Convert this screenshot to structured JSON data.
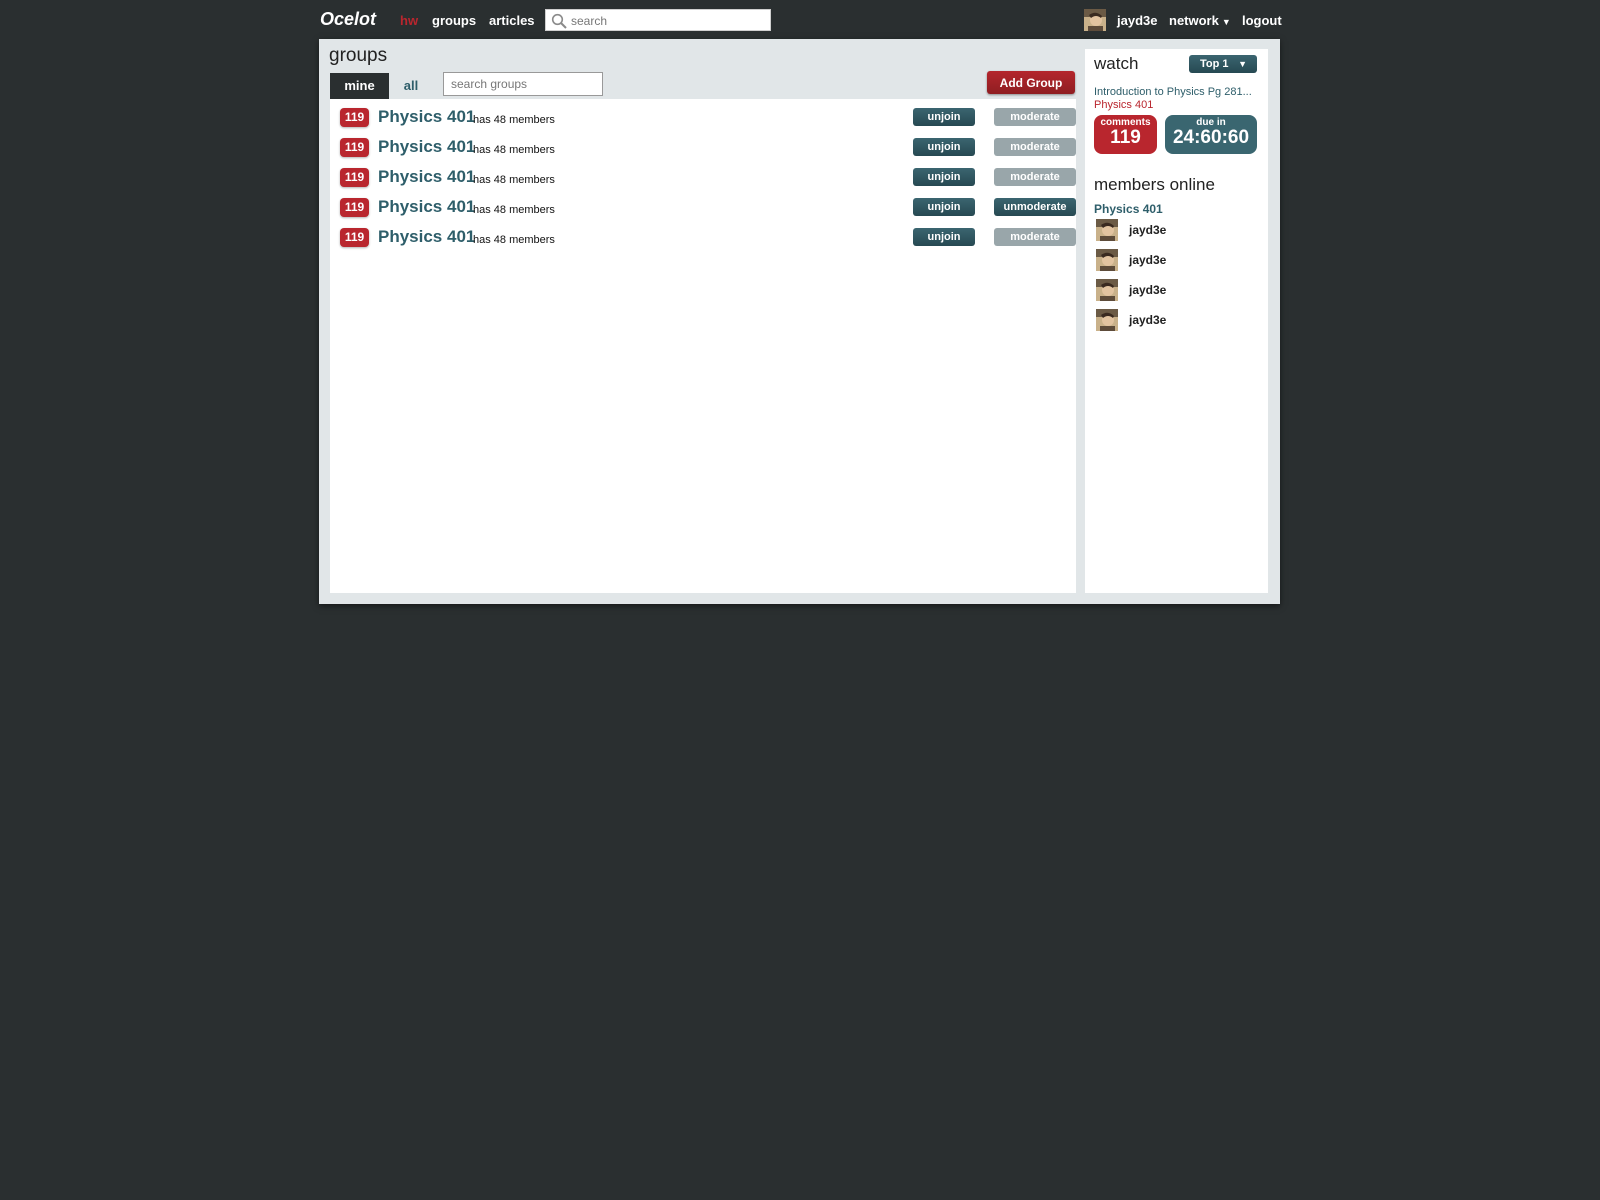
{
  "topbar": {
    "logo": "Ocelot",
    "nav": {
      "hw": "hw",
      "groups": "groups",
      "articles": "articles"
    },
    "search_placeholder": "search",
    "username": "jayd3e",
    "network_label": "network",
    "logout_label": "logout"
  },
  "groups_page": {
    "title": "groups",
    "tabs": {
      "mine": "mine",
      "all": "all"
    },
    "search_placeholder": "search groups",
    "add_group_label": "Add Group",
    "rows": [
      {
        "count": "119",
        "name": "Physics 401",
        "members": "has 48 members",
        "unjoin": "unjoin",
        "moderate": "moderate",
        "moderating": false
      },
      {
        "count": "119",
        "name": "Physics 401",
        "members": "has 48 members",
        "unjoin": "unjoin",
        "moderate": "moderate",
        "moderating": false
      },
      {
        "count": "119",
        "name": "Physics 401",
        "members": "has 48 members",
        "unjoin": "unjoin",
        "moderate": "moderate",
        "moderating": false
      },
      {
        "count": "119",
        "name": "Physics 401",
        "members": "has 48 members",
        "unjoin": "unjoin",
        "moderate": "unmoderate",
        "moderating": true
      },
      {
        "count": "119",
        "name": "Physics 401",
        "members": "has 48 members",
        "unjoin": "unjoin",
        "moderate": "moderate",
        "moderating": false
      }
    ]
  },
  "sidebar": {
    "watch_title": "watch",
    "top_select": "Top 1",
    "article_title": "Introduction to Physics Pg 281...",
    "article_group": "Physics 401",
    "comments_label": "comments",
    "comments_value": "119",
    "due_label": "due in",
    "due_value": "24:60:60",
    "online_title": "members online",
    "online_group": "Physics 401",
    "members": [
      "jayd3e",
      "jayd3e",
      "jayd3e",
      "jayd3e"
    ]
  },
  "colors": {
    "background": "#2a2f30",
    "accent_red": "#b9262e",
    "accent_teal": "#2e5e6a",
    "panel": "#e1e6e8"
  },
  "icons": {
    "search": "search-icon",
    "caret": "chevron-down-icon",
    "avatar": "avatar"
  }
}
